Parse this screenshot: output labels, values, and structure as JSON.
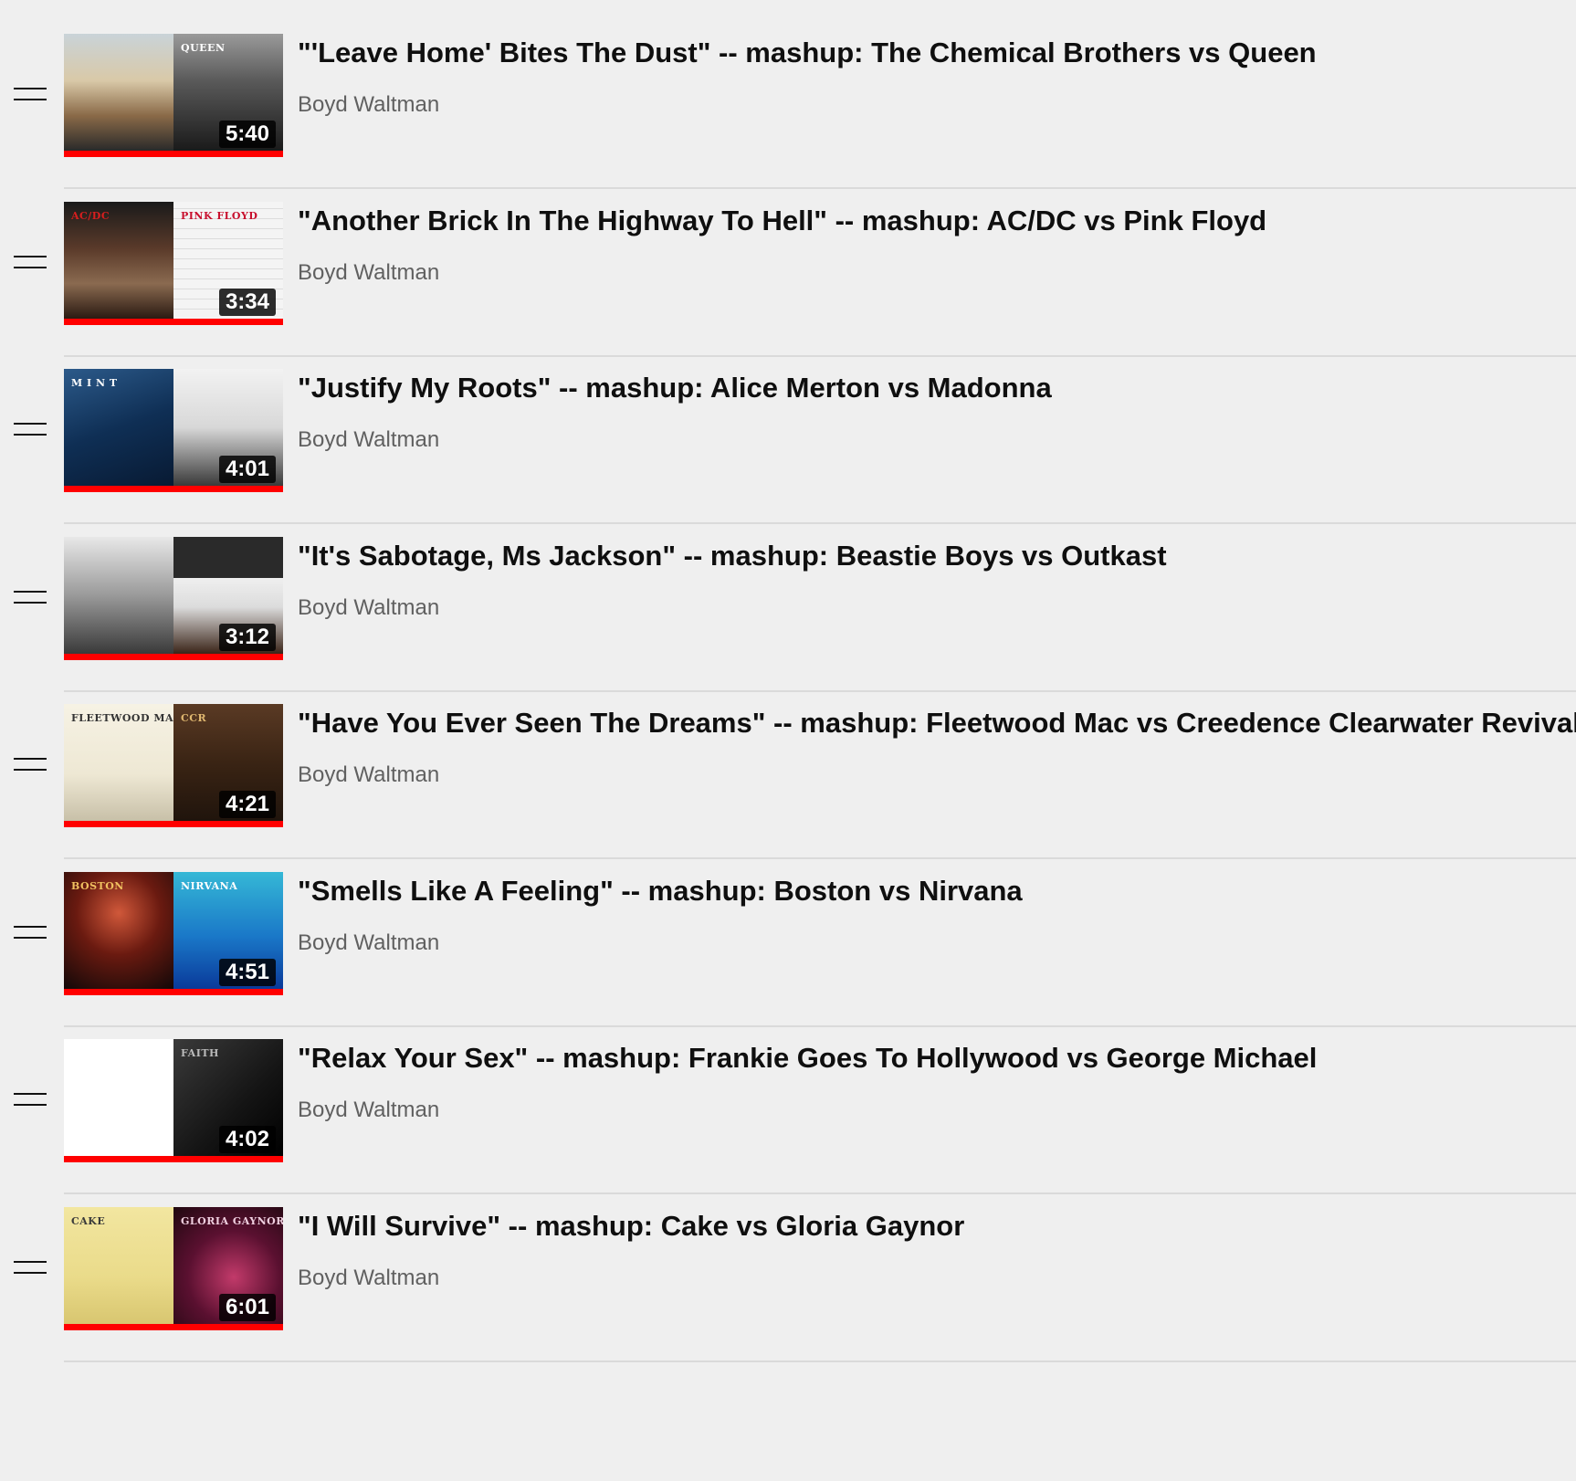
{
  "playlist": {
    "items": [
      {
        "title": "\"'Leave Home' Bites The Dust\" -- mashup: The Chemical Brothers vs Queen",
        "channel": "Boyd Waltman",
        "duration": "5:40",
        "watched_fraction": 1.0,
        "art": {
          "left": {
            "bg": "linear-gradient(180deg,#c9d3d8 0%,#d9c9a8 40%,#8a6a48 70%,#2a2a2a 100%)",
            "caption": "",
            "color": "#ffffff"
          },
          "right": {
            "bg": "linear-gradient(180deg,#9a9a9a 0%,#5a5a5a 40%,#1a1a1a 100%)",
            "caption": "QUEEN",
            "color": "#ffffff"
          }
        }
      },
      {
        "title": "\"Another Brick In The Highway To Hell\" -- mashup: AC/DC vs Pink Floyd",
        "channel": "Boyd Waltman",
        "duration": "3:34",
        "watched_fraction": 1.0,
        "art": {
          "left": {
            "bg": "linear-gradient(180deg,#1a1a1a 0%,#5a3a2a 40%,#8a6a50 70%,#2a1a12 100%)",
            "caption": "AC/DC",
            "color": "#d81e1e"
          },
          "right": {
            "bg": "repeating-linear-gradient(0deg,#f4f4f4 0px,#f4f4f4 10px,#dcdcdc 10px,#dcdcdc 11px)",
            "caption": "PINK FLOYD",
            "color": "#c8102e"
          }
        }
      },
      {
        "title": "\"Justify My Roots\" -- mashup: Alice Merton vs Madonna",
        "channel": "Boyd Waltman",
        "duration": "4:01",
        "watched_fraction": 1.0,
        "art": {
          "left": {
            "bg": "linear-gradient(160deg,#2c5a8a 0%,#0f2f55 50%,#081a33 100%)",
            "caption": "M I N T",
            "color": "#ffffff"
          },
          "right": {
            "bg": "linear-gradient(180deg,#f2f2f2 0%,#d8d8d8 50%,#3a3a3a 100%)",
            "caption": "",
            "color": "#000000"
          }
        }
      },
      {
        "title": "\"It's Sabotage, Ms Jackson\" -- mashup: Beastie Boys vs Outkast",
        "channel": "Boyd Waltman",
        "duration": "3:12",
        "watched_fraction": 1.0,
        "art": {
          "left": {
            "bg": "linear-gradient(180deg,#e8e8e8 0%,#9a9a9a 50%,#3a3a3a 100%)",
            "caption": "",
            "color": "#000000"
          },
          "right": {
            "bg": "linear-gradient(180deg,#2a2a2a 0%,#2a2a2a 35%,#efefef 35%,#dcdcdc 60%,#3a2418 100%)",
            "caption": "",
            "color": "#ffffff"
          }
        }
      },
      {
        "title": "\"Have You Ever Seen The Dreams\" -- mashup: Fleetwood Mac vs Creedence Clearwater Revival",
        "channel": "Boyd Waltman",
        "duration": "4:21",
        "watched_fraction": 1.0,
        "art": {
          "left": {
            "bg": "linear-gradient(180deg,#f6f2e4 0%,#eee8d4 60%,#c8c0a8 100%)",
            "caption": "FLEETWOOD MAC",
            "color": "#333333"
          },
          "right": {
            "bg": "linear-gradient(180deg,#5a3a24 0%,#3a2414 50%,#20140c 100%)",
            "caption": "CCR",
            "color": "#e0b870"
          }
        }
      },
      {
        "title": "\"Smells Like A Feeling\" -- mashup: Boston vs Nirvana",
        "channel": "Boyd Waltman",
        "duration": "4:51",
        "watched_fraction": 1.0,
        "art": {
          "left": {
            "bg": "radial-gradient(circle at 50% 35%,#d0583a 0%,#6a1a10 45%,#120808 100%)",
            "caption": "BOSTON",
            "color": "#f0c060"
          },
          "right": {
            "bg": "linear-gradient(180deg,#35b8d6 0%,#1a78c8 55%,#0a3a9a 100%)",
            "caption": "NIRVANA",
            "color": "#ffffff"
          }
        }
      },
      {
        "title": "\"Relax Your Sex\" -- mashup: Frankie Goes To Hollywood vs George Michael",
        "channel": "Boyd Waltman",
        "duration": "4:02",
        "watched_fraction": 1.0,
        "art": {
          "left": {
            "bg": "linear-gradient(180deg,#ffffff 0%,#ffffff 100%)",
            "caption": "",
            "color": "#000000"
          },
          "right": {
            "bg": "linear-gradient(135deg,#3a3a3a 0%,#141414 60%,#000000 100%)",
            "caption": "FAITH",
            "color": "#bbbbbb"
          }
        }
      },
      {
        "title": "\"I Will Survive\" -- mashup: Cake vs Gloria Gaynor",
        "channel": "Boyd Waltman",
        "duration": "6:01",
        "watched_fraction": 1.0,
        "art": {
          "left": {
            "bg": "linear-gradient(180deg,#f2e6a0 0%,#eadb8a 60%,#d8c670 100%)",
            "caption": "CAKE",
            "color": "#3a3a3a"
          },
          "right": {
            "bg": "radial-gradient(circle at 55% 60%,#c23a6a 0%,#5a1030 50%,#200810 100%)",
            "caption": "GLORIA GAYNOR",
            "color": "#f0d0e0"
          }
        }
      }
    ]
  }
}
